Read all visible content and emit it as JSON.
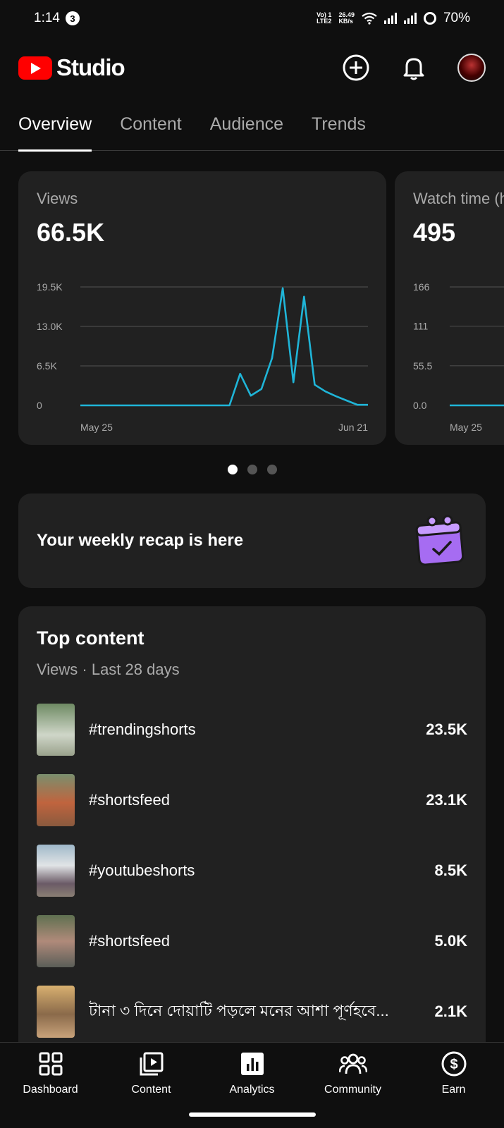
{
  "status_bar": {
    "time": "1:14",
    "notification_count": "3",
    "network_label_top": "Vo) 1",
    "network_label_bottom": "LTE2",
    "speed_value": "26.49",
    "speed_unit": "KB/s",
    "battery": "70%"
  },
  "header": {
    "logo_text": "Studio",
    "icons": [
      "create-icon",
      "notification-bell-icon",
      "avatar"
    ]
  },
  "tabs": [
    {
      "label": "Overview",
      "active": true
    },
    {
      "label": "Content",
      "active": false
    },
    {
      "label": "Audience",
      "active": false
    },
    {
      "label": "Trends",
      "active": false
    }
  ],
  "metrics": [
    {
      "label": "Views",
      "value": "66.5K",
      "y_ticks": [
        "19.5K",
        "13.0K",
        "6.5K",
        "0"
      ],
      "x_labels": [
        "May 25",
        "Jun 21"
      ]
    },
    {
      "label": "Watch time (hours)",
      "value": "495",
      "y_ticks": [
        "166",
        "111",
        "55.5",
        "0.0"
      ],
      "x_labels": [
        "May 25"
      ]
    }
  ],
  "chart_data": {
    "type": "line",
    "title": "Views",
    "x": [
      "May 25",
      "May 26",
      "May 27",
      "May 28",
      "May 29",
      "May 30",
      "May 31",
      "Jun 1",
      "Jun 2",
      "Jun 3",
      "Jun 4",
      "Jun 5",
      "Jun 6",
      "Jun 7",
      "Jun 8",
      "Jun 9",
      "Jun 10",
      "Jun 11",
      "Jun 12",
      "Jun 13",
      "Jun 14",
      "Jun 15",
      "Jun 16",
      "Jun 17",
      "Jun 18",
      "Jun 19",
      "Jun 20",
      "Jun 21"
    ],
    "series": [
      {
        "values": [
          0,
          0,
          0,
          0,
          0,
          0,
          0,
          0,
          0,
          0,
          0,
          0,
          0,
          0,
          0,
          5200,
          1600,
          2700,
          7800,
          19300,
          3800,
          17900,
          3400,
          2300,
          1500,
          800,
          100,
          100
        ]
      }
    ],
    "ylim": [
      0,
      19500
    ],
    "y_ticks": [
      0,
      6500,
      13000,
      19500
    ],
    "grid": true,
    "color": "#1fb5d8"
  },
  "watch_chart": {
    "values": [
      0,
      0,
      0,
      0,
      0
    ],
    "ylim": [
      0,
      166
    ]
  },
  "carousel_dots": {
    "count": 3,
    "active": 0
  },
  "recap": {
    "text": "Your weekly recap is here",
    "icon": "calendar-recap-icon"
  },
  "top_content": {
    "title": "Top content",
    "subtitle": "Views · Last 28 days",
    "items": [
      {
        "title": "#trendingshorts",
        "views": "23.5K",
        "thumb_color": "#8a9a78"
      },
      {
        "title": "#shortsfeed",
        "views": "23.1K",
        "thumb_color": "#a8664a"
      },
      {
        "title": "#youtubeshorts",
        "views": "8.5K",
        "thumb_color": "#7d8d9a"
      },
      {
        "title": "#shortsfeed",
        "views": "5.0K",
        "thumb_color": "#6e7a5c"
      },
      {
        "title": "টানা ৩ দিনে দোয়াটি পড়লে মনের আশা পূর্ণহবে...",
        "views": "2.1K",
        "thumb_color": "#b08a5a"
      }
    ]
  },
  "bottom_nav": [
    {
      "label": "Dashboard",
      "icon": "dashboard-icon",
      "active": false
    },
    {
      "label": "Content",
      "icon": "content-icon",
      "active": false
    },
    {
      "label": "Analytics",
      "icon": "analytics-icon",
      "active": true
    },
    {
      "label": "Community",
      "icon": "community-icon",
      "active": false
    },
    {
      "label": "Earn",
      "icon": "earn-icon",
      "active": false
    }
  ]
}
